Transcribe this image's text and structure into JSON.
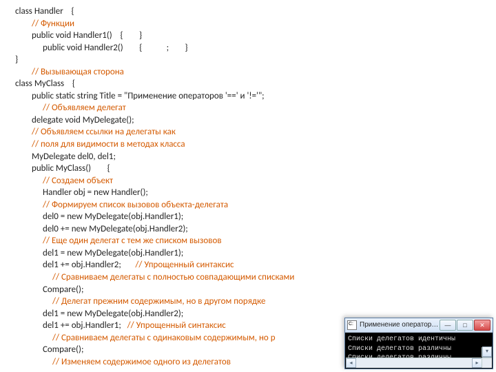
{
  "lines": [
    {
      "cls": "indent0 txt",
      "text": "class Handler    {"
    },
    {
      "cls": "indent1 comment",
      "text": "// Функции"
    },
    {
      "cls": "indent1 txt",
      "text": "public void Handler1()    {        }"
    },
    {
      "cls": "indent2 txt",
      "text": "public void Handler2()        {            ;        }"
    },
    {
      "cls": "indent0 txt",
      "text": "}"
    },
    {
      "cls": "indent1 comment",
      "text": "// Вызывающая сторона"
    },
    {
      "cls": "indent0 txt",
      "text": "class MyClass    {"
    },
    {
      "cls": "indent1 txt",
      "text": "public static string Title = \"Применение операторов '==' и '!='\";"
    },
    {
      "cls": "indent2 comment",
      "text": "// Объявляем делегат"
    },
    {
      "cls": "indent1 txt",
      "text": "delegate void MyDelegate();"
    },
    {
      "cls": "indent1 comment",
      "text": "// Объявляем ссылки на делегаты как"
    },
    {
      "cls": "indent1 comment",
      "text": "// поля для видимости в методах класса"
    },
    {
      "cls": "indent1 txt",
      "text": "MyDelegate del0, del1;"
    },
    {
      "cls": "indent1 txt",
      "text": "public MyClass()        {"
    },
    {
      "cls": "indent2 comment",
      "text": "// Создаем объект"
    },
    {
      "cls": "indent2 txt",
      "text": "Handler obj = new Handler();"
    },
    {
      "cls": "indent2 comment",
      "text": "// Формируем список вызовов объекта-делегата"
    },
    {
      "cls": "indent2 txt",
      "text": "del0 = new MyDelegate(obj.Handler1);"
    },
    {
      "cls": "indent2 txt",
      "text": "del0 += new MyDelegate(obj.Handler2);"
    },
    {
      "cls": "indent2 comment",
      "text": "// Еще один делегат с тем же списком вызовов"
    },
    {
      "cls": "indent2 txt",
      "text": "del1 = new MyDelegate(obj.Handler1);"
    },
    {
      "cls": "indent2",
      "html": true,
      "text": "<span class='txt'>del1 += obj.Handler2;       </span><span class='comment'>// Упрощенный синтаксис</span>"
    },
    {
      "cls": "indent3 comment",
      "text": "// Сравниваем делегаты с полностью совпадающими списками"
    },
    {
      "cls": "indent2 txt",
      "text": "Compare();"
    },
    {
      "cls": "indent3 comment",
      "text": "// Делегат прежним содержимым, но в другом порядке"
    },
    {
      "cls": "indent2 txt",
      "text": "del1 = new MyDelegate(obj.Handler2);"
    },
    {
      "cls": "indent2",
      "html": true,
      "text": "<span class='txt'>del1 += obj.Handler1;   </span><span class='comment'>// Упрощенный синтаксис</span>"
    },
    {
      "cls": "indent3 comment",
      "text": "// Сравниваем делегаты с одинаковым содержимым, но р"
    },
    {
      "cls": "indent2 txt",
      "text": "Compare();"
    },
    {
      "cls": "indent3 comment",
      "text": "// Изменяем содержимое одного из делегатов"
    }
  ],
  "console": {
    "title": "Применение операторов '...",
    "lines": [
      "Списки делегатов идентичны",
      "Списки делегатов различны",
      "Списки делегатов различны"
    ],
    "buttons": {
      "min": "—",
      "max": "□",
      "close": "✕"
    },
    "arrows": {
      "up": "▴",
      "down": "▾",
      "left": "◂",
      "right": "▸"
    }
  }
}
